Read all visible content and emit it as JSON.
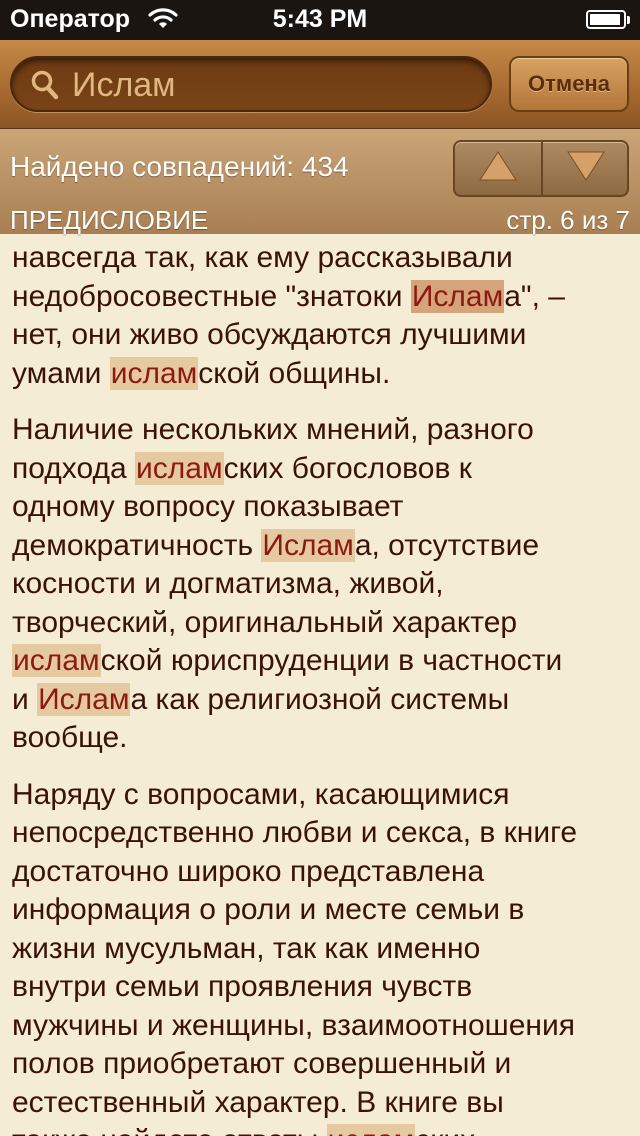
{
  "status_bar": {
    "carrier": "Оператор",
    "time": "5:43 PM"
  },
  "search": {
    "query": "Ислам",
    "cancel_label": "Отмена"
  },
  "results": {
    "count_text": "Найдено совпадений: 434",
    "section_title": "ПРЕДИСЛОВИЕ",
    "page_info": "стр. 6 из 7"
  },
  "content": {
    "paragraphs": [
      {
        "lines": [
          [
            {
              "t": "навсегда так, как ему рассказывали"
            }
          ],
          [
            {
              "t": "недобросовестные \"знатоки "
            },
            {
              "t": "Ислам",
              "hl": true,
              "active": true
            },
            {
              "t": "а\", –"
            }
          ],
          [
            {
              "t": "нет, они живо обсуждаются лучшими"
            }
          ],
          [
            {
              "t": "умами "
            },
            {
              "t": "ислам",
              "hl": true
            },
            {
              "t": "ской общины."
            }
          ]
        ]
      },
      {
        "lines": [
          [
            {
              "t": "Наличие нескольких мнений, разного"
            }
          ],
          [
            {
              "t": "подхода "
            },
            {
              "t": "ислам",
              "hl": true
            },
            {
              "t": "ских богословов к"
            }
          ],
          [
            {
              "t": "одному вопросу показывает"
            }
          ],
          [
            {
              "t": "демократичность "
            },
            {
              "t": "Ислам",
              "hl": true
            },
            {
              "t": "а, отсутствие"
            }
          ],
          [
            {
              "t": "косности и догматизма, живой,"
            }
          ],
          [
            {
              "t": "творческий, оригинальный характер"
            }
          ],
          [
            {
              "t": "ислам",
              "hl": true
            },
            {
              "t": "ской юриспруденции в частности"
            }
          ],
          [
            {
              "t": "и "
            },
            {
              "t": "Ислам",
              "hl": true
            },
            {
              "t": "а как религиозной системы"
            }
          ],
          [
            {
              "t": "вообще."
            }
          ]
        ]
      },
      {
        "lines": [
          [
            {
              "t": "Наряду с вопросами, касающимися"
            }
          ],
          [
            {
              "t": "непосредственно любви и секса, в книге"
            }
          ],
          [
            {
              "t": "достаточно широко представлена"
            }
          ],
          [
            {
              "t": "информация о роли и месте семьи в"
            }
          ],
          [
            {
              "t": "жизни мусульман, так как именно"
            }
          ],
          [
            {
              "t": "внутри семьи проявления чувств"
            }
          ],
          [
            {
              "t": "мужчины и женщины, взаимоотношения"
            }
          ],
          [
            {
              "t": "полов приобретают совершенный и"
            }
          ],
          [
            {
              "t": "естественный характер. В книге вы"
            }
          ],
          [
            {
              "t": "также найдете ответы "
            },
            {
              "t": "ислам",
              "hl": true
            },
            {
              "t": "ских"
            }
          ]
        ]
      }
    ]
  },
  "icons": {
    "wifi": "wifi-icon",
    "battery": "battery-icon",
    "search": "magnifier-icon",
    "prev": "arrow-up-icon",
    "next": "arrow-down-icon"
  },
  "colors": {
    "highlight": "#e5c9a1",
    "highlight_active": "#d6a47a",
    "highlight_text": "#8c1a12",
    "body_text": "#3a1208",
    "page_bg": "#f5ecd6"
  }
}
